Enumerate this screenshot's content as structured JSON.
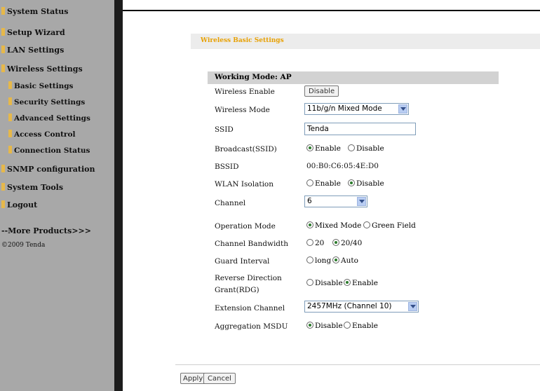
{
  "sidebar": {
    "items": [
      {
        "label": "System Status"
      },
      {
        "label": "Setup Wizard"
      },
      {
        "label": "LAN Settings"
      },
      {
        "label": "Wireless Settings"
      },
      {
        "label": "Basic Settings"
      },
      {
        "label": "Security Settings"
      },
      {
        "label": "Advanced Settings"
      },
      {
        "label": "Access Control"
      },
      {
        "label": "Connection Status"
      },
      {
        "label": "SNMP configuration"
      },
      {
        "label": "System Tools"
      },
      {
        "label": "Logout"
      }
    ],
    "more_products": "--More Products>>>",
    "copyright": "©2009 Tenda"
  },
  "banner": {
    "title": "Wireless Basic Settings"
  },
  "section": {
    "title": "Working Mode: AP"
  },
  "form": {
    "wireless_enable": {
      "label": "Wireless Enable",
      "button": "Disable"
    },
    "wireless_mode": {
      "label": "Wireless Mode",
      "value": "11b/g/n Mixed Mode"
    },
    "ssid": {
      "label": "SSID",
      "value": "Tenda"
    },
    "broadcast": {
      "label": "Broadcast(SSID)",
      "opt1": "Enable",
      "opt2": "Disable",
      "selected": "Enable"
    },
    "bssid": {
      "label": "BSSID",
      "value": "00:B0:C6:05:4E:D0"
    },
    "wlan_isolation": {
      "label": "WLAN Isolation",
      "opt1": "Enable",
      "opt2": "Disable",
      "selected": "Disable"
    },
    "channel": {
      "label": "Channel",
      "value": "6"
    },
    "operation_mode": {
      "label": "Operation Mode",
      "opt1": "Mixed Mode",
      "opt2": "Green Field",
      "selected": "Mixed Mode"
    },
    "channel_bandwidth": {
      "label": "Channel Bandwidth",
      "opt1": "20",
      "opt2": "20/40",
      "selected": "20/40"
    },
    "guard_interval": {
      "label": "Guard Interval",
      "opt1": "long",
      "opt2": "Auto",
      "selected": "Auto"
    },
    "rdg": {
      "label_line1": "Reverse Direction",
      "label_line2": "Grant(RDG)",
      "opt1": "Disable",
      "opt2": "Enable",
      "selected": "Enable"
    },
    "extension_channel": {
      "label": "Extension Channel",
      "value": "2457MHz (Channel 10)"
    },
    "aggregation_msdu": {
      "label": "Aggregation MSDU",
      "opt1": "Disable",
      "opt2": "Enable",
      "selected": "Disable"
    }
  },
  "footer": {
    "apply": "Apply",
    "cancel": "Cancel"
  },
  "colors": {
    "sidebar_bg": "#a8a8a8",
    "accent": "#e8a000",
    "section_bg": "#d2d2d2"
  }
}
